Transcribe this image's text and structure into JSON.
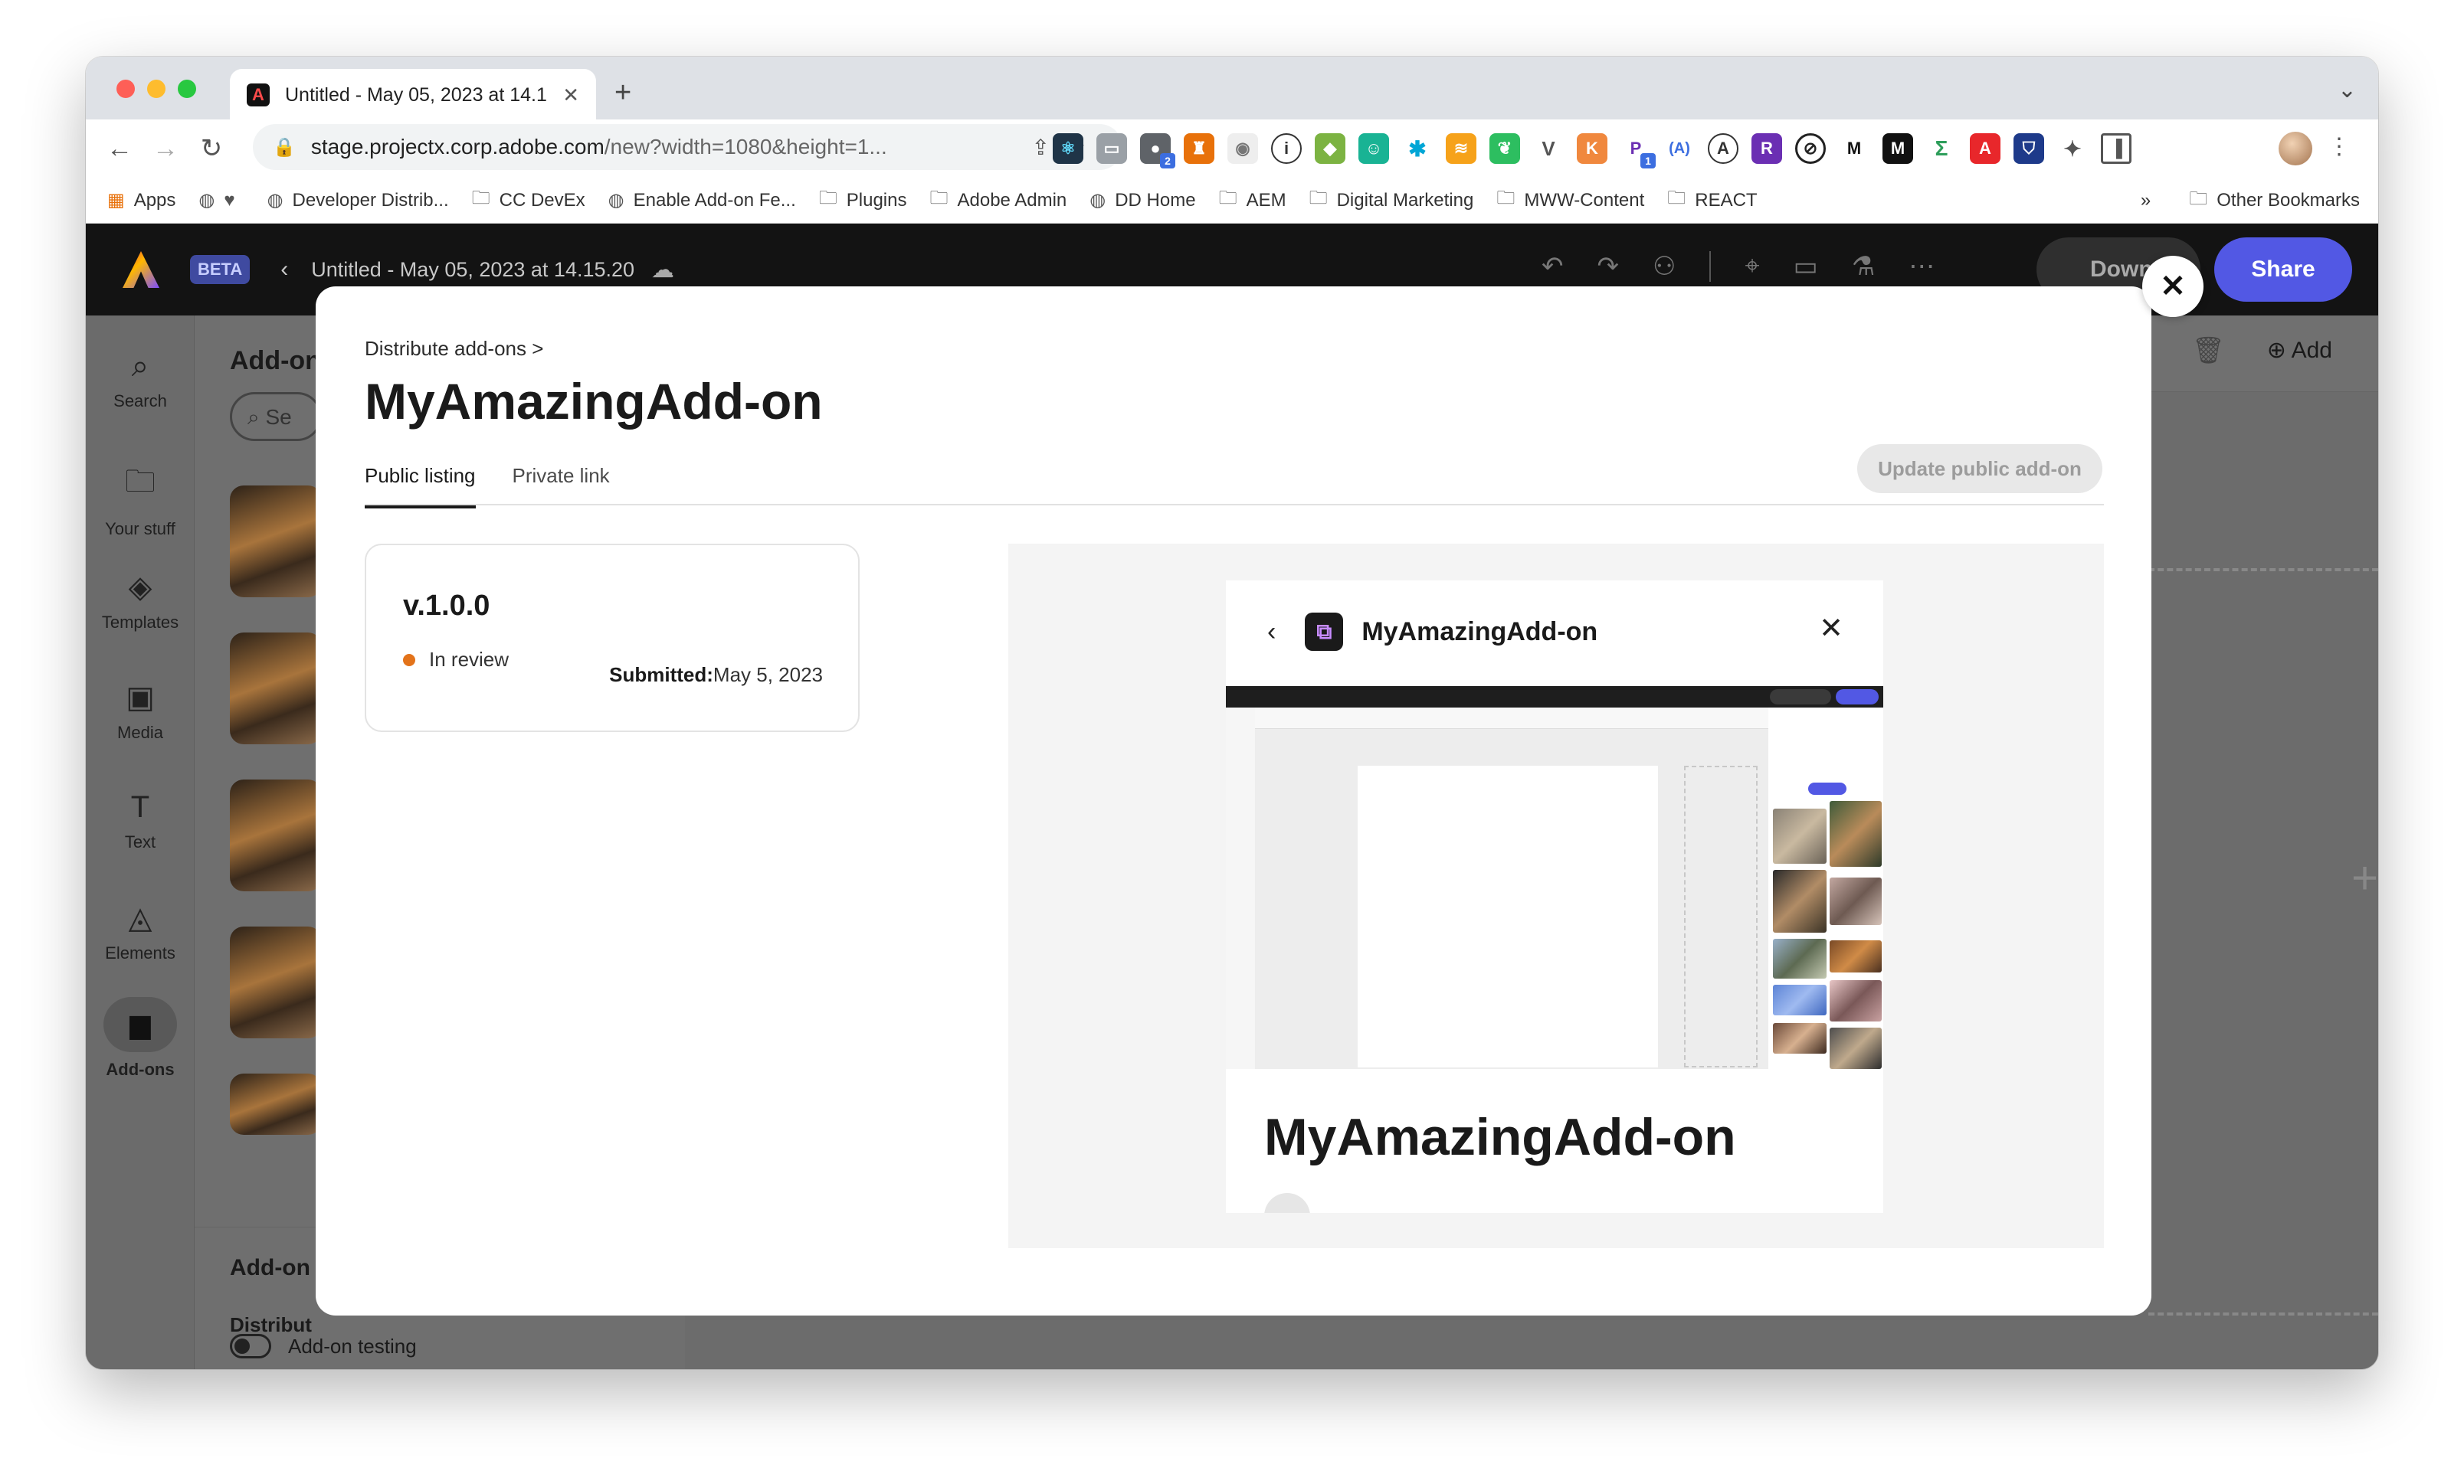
{
  "browser": {
    "tab_title": "Untitled - May 05, 2023 at 14.1",
    "new_tab": "+",
    "url_host": "stage.projectx.corp.adobe.com",
    "url_path": "/new?width=1080&height=1...",
    "bookmarks": [
      "Apps",
      "Developer Distrib...",
      "CC DevEx",
      "Enable Add-on Fe...",
      "Plugins",
      "Adobe Admin",
      "DD Home",
      "AEM",
      "Digital Marketing",
      "MWW-Content",
      "REACT"
    ],
    "bookmarks_overflow": "»",
    "other_bookmarks": "Other Bookmarks",
    "extension_badge_a": "2",
    "extension_badge_b": "1"
  },
  "app": {
    "beta_label": "BETA",
    "doc_title": "Untitled - May 05, 2023 at 14.15.20",
    "download_label": "Down",
    "share_label": "Share",
    "rail": [
      "Search",
      "Your stuff",
      "Templates",
      "Media",
      "Text",
      "Elements",
      "Add-ons"
    ],
    "panel_title": "Add-on",
    "panel_search_placeholder": "Se",
    "panel_bottom_title": "Add-on",
    "panel_bottom_sub": "Distribut",
    "addon_testing_label": "Add-on testing",
    "canvas_add_label": "Add"
  },
  "modal": {
    "breadcrumb": "Distribute add-ons >",
    "title": "MyAmazingAdd-on",
    "tabs": [
      "Public listing",
      "Private link"
    ],
    "update_button": "Update public add-on",
    "version": "v.1.0.0",
    "status": "In review",
    "submitted_label": "Submitted:",
    "submitted_date": "May 5, 2023",
    "preview_name": "MyAmazingAdd-on",
    "preview_big_title": "MyAmazingAdd-on",
    "close_symbol": "✕"
  },
  "colors": {
    "accent": "#5258e4",
    "status_dot": "#e3731a",
    "app_header": "#131313"
  }
}
